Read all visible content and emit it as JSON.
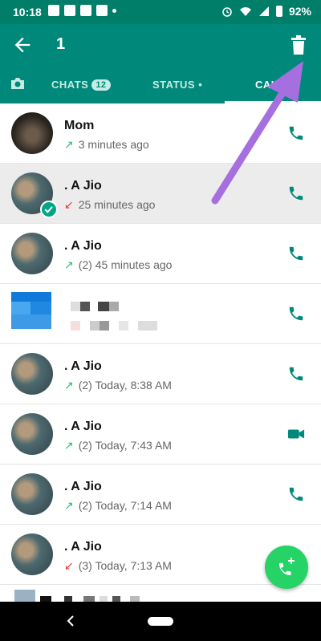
{
  "status_bar": {
    "time": "10:18",
    "battery": "92%"
  },
  "app_bar": {
    "selected_count": "1"
  },
  "tabs": {
    "chats": "CHATS",
    "chats_badge": "12",
    "status": "STATUS",
    "calls": "CALLS"
  },
  "calls": [
    {
      "name": "Mom",
      "detail": "3 minutes ago",
      "direction": "outgoing",
      "type": "voice"
    },
    {
      "name": ". A Jio",
      "detail": "25 minutes ago",
      "direction": "missed",
      "type": "voice",
      "selected": true
    },
    {
      "name": ". A Jio",
      "detail": "(2)  45 minutes ago",
      "direction": "outgoing",
      "type": "voice"
    },
    {
      "name": "",
      "detail": "",
      "direction": "",
      "type": "voice",
      "blurred": true
    },
    {
      "name": ". A Jio",
      "detail": "(2)  Today, 8:38 AM",
      "direction": "outgoing",
      "type": "voice"
    },
    {
      "name": ". A Jio",
      "detail": "(2)  Today, 7:43 AM",
      "direction": "outgoing",
      "type": "video"
    },
    {
      "name": ". A Jio",
      "detail": "(2)  Today, 7:14 AM",
      "direction": "outgoing",
      "type": "voice"
    },
    {
      "name": ". A Jio",
      "detail": "(3)  Today, 7:13 AM",
      "direction": "missed",
      "type": "voice"
    }
  ],
  "colors": {
    "teal": "#00897b",
    "teal_dark": "#007e6a",
    "accent_green": "#25d366",
    "outgoing": "#25c16f",
    "missed": "#e53935",
    "annotation": "#a66fe0"
  }
}
